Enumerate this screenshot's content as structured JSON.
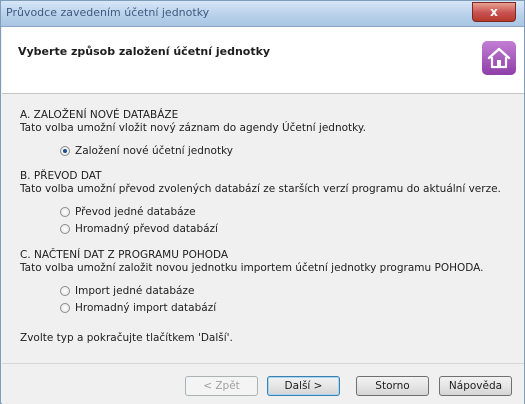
{
  "window": {
    "title": "Průvodce zavedením účetní jednotky",
    "close_label": "x"
  },
  "header": {
    "title": "Vyberte způsob založení účetní jednotky",
    "icon": "home-icon"
  },
  "sections": [
    {
      "title": "A. ZALOŽENÍ NOVÉ DATABÁZE",
      "description": "Tato volba umožní vložit nový záznam do agendy Účetní jednotky.",
      "options": [
        {
          "label": "Založení nové účetní jednotky",
          "checked": true
        }
      ]
    },
    {
      "title": "B. PŘEVOD DAT",
      "description": "Tato volba umožní převod zvolených databází ze starších verzí programu do aktuální verze.",
      "options": [
        {
          "label": "Převod jedné databáze",
          "checked": false
        },
        {
          "label": "Hromadný převod databází",
          "checked": false
        }
      ]
    },
    {
      "title": "C. NAČTENÍ DAT Z PROGRAMU POHODA",
      "description": "Tato volba umožní založit novou jednotku importem účetní jednotky programu POHODA.",
      "options": [
        {
          "label": "Import jedné databáze",
          "checked": false
        },
        {
          "label": "Hromadný import databází",
          "checked": false
        }
      ]
    }
  ],
  "footer_note": "Zvolte typ a pokračujte tlačítkem 'Další'.",
  "buttons": {
    "back": "< Zpět",
    "next": "Další >",
    "cancel": "Storno",
    "help": "Nápověda"
  }
}
